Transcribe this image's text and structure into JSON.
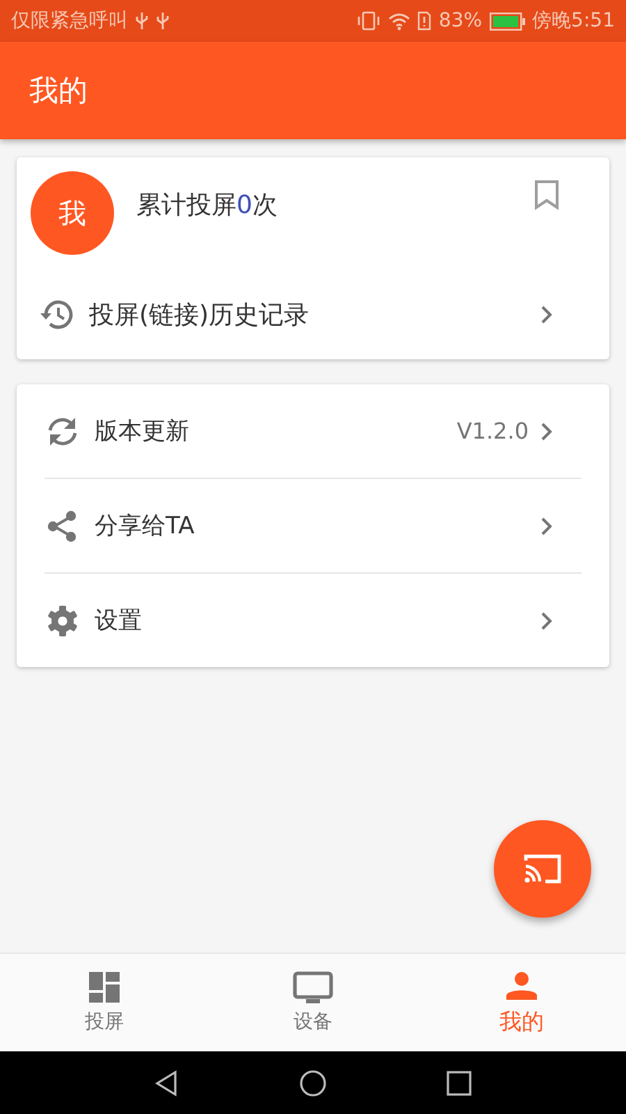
{
  "status_bar": {
    "carrier": "仅限紧急呼叫",
    "battery": "83%",
    "time": "傍晚5:51"
  },
  "app_bar": {
    "title": "我的"
  },
  "profile_card": {
    "avatar": "我",
    "cast_count": {
      "prefix": "累计投屏",
      "count": "0",
      "suffix": "次"
    },
    "history": "投屏(链接)历史记录"
  },
  "menu": [
    {
      "label": "版本更新",
      "value": "V1.2.0"
    },
    {
      "label": "分享给TA"
    },
    {
      "label": "设置"
    }
  ],
  "bottom_nav": [
    {
      "label": "投屏",
      "selected": false
    },
    {
      "label": "设备",
      "selected": false
    },
    {
      "label": "我的",
      "selected": true
    }
  ]
}
